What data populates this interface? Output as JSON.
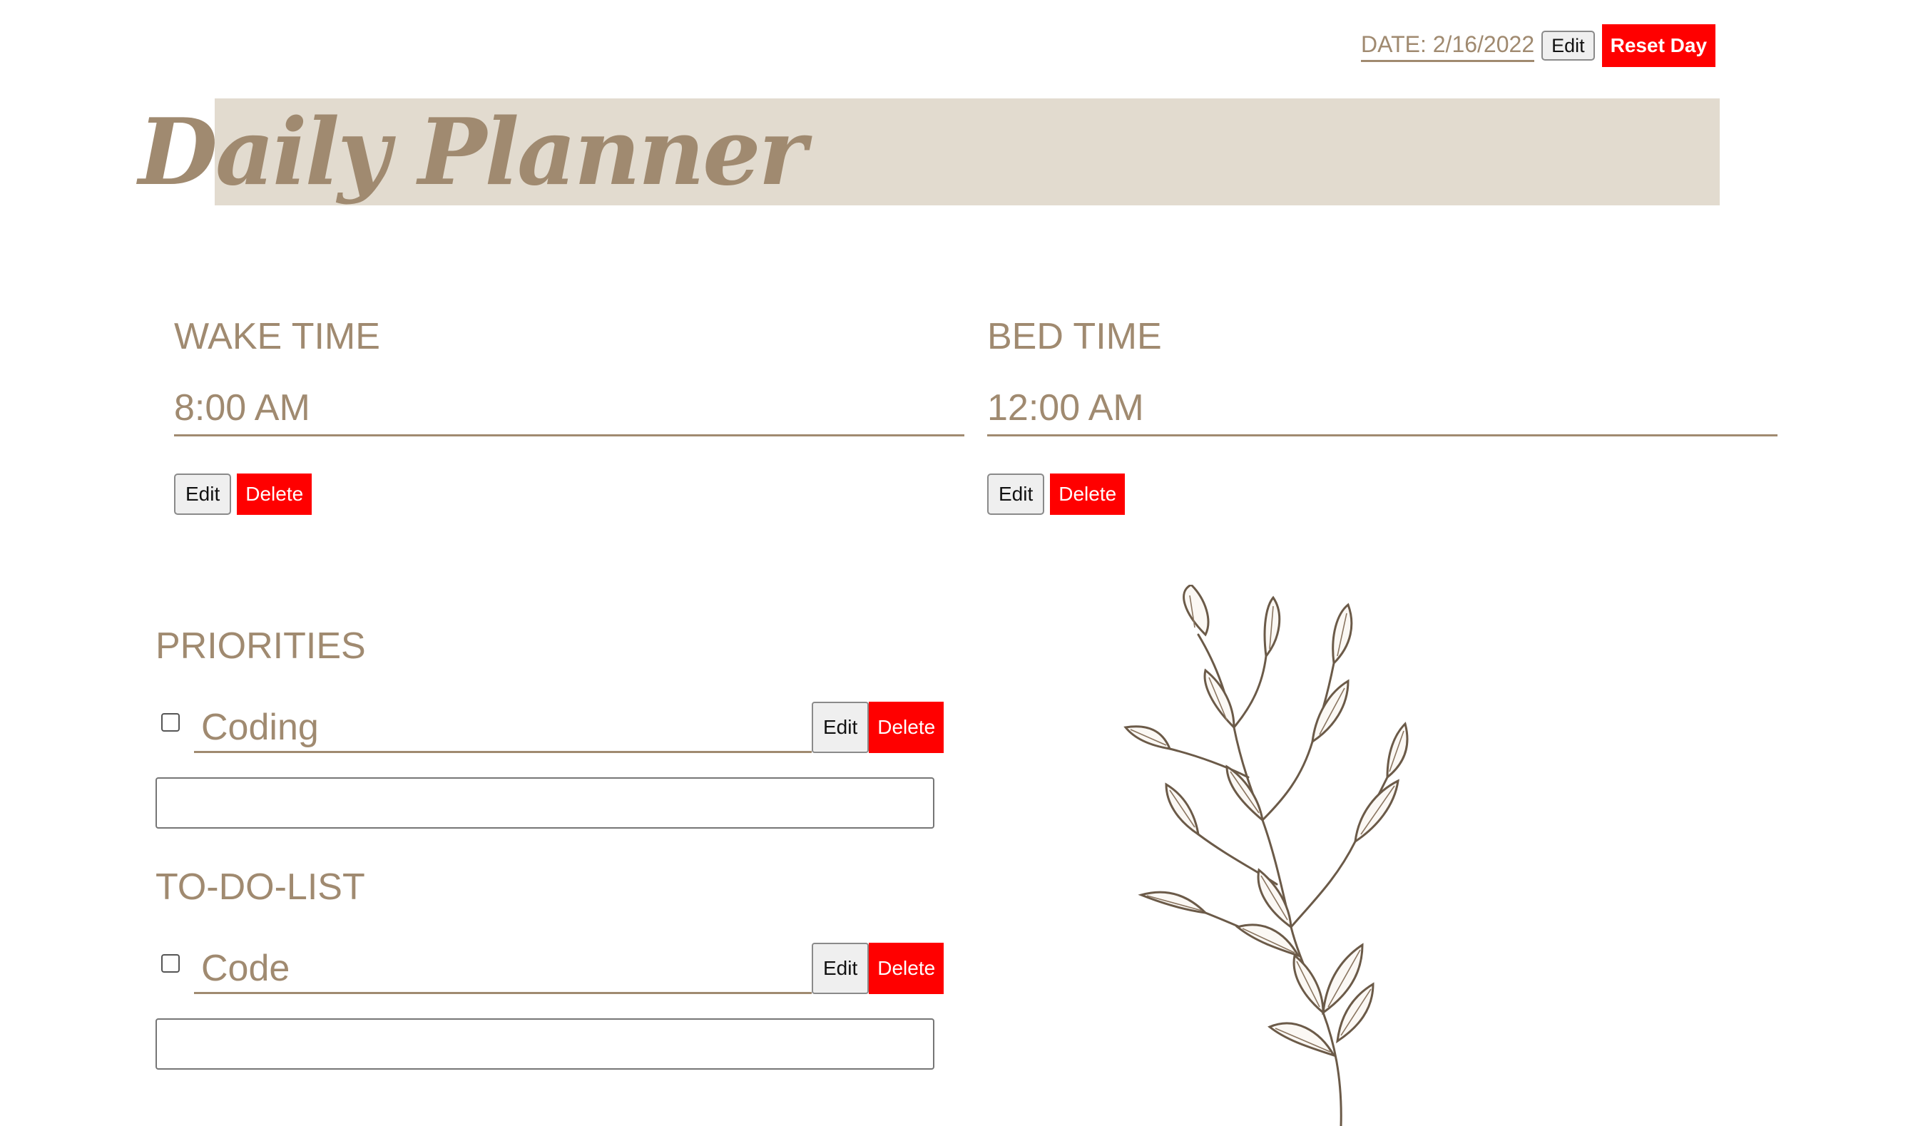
{
  "header": {
    "date_label": "DATE: 2/16/2022",
    "date_edit_label": "Edit",
    "reset_label": "Reset Day",
    "title": "Daily Planner"
  },
  "wake": {
    "heading": "WAKE TIME",
    "value": "8:00 AM",
    "edit_label": "Edit",
    "delete_label": "Delete"
  },
  "bed": {
    "heading": "BED TIME",
    "value": "12:00 AM",
    "edit_label": "Edit",
    "delete_label": "Delete"
  },
  "priorities": {
    "heading": "PRIORITIES",
    "items": [
      {
        "text": "Coding",
        "checked": false,
        "edit_label": "Edit",
        "delete_label": "Delete"
      }
    ],
    "new_item_value": ""
  },
  "todo": {
    "heading": "TO-DO-LIST",
    "items": [
      {
        "text": "Code",
        "checked": false,
        "edit_label": "Edit",
        "delete_label": "Delete"
      }
    ],
    "new_item_value": ""
  },
  "colors": {
    "accent": "#a08a70",
    "header_band": "#e2dbcf",
    "danger": "#ff0000",
    "button_gray": "#efefef"
  },
  "icons": {
    "illustration": "leaf-branch-illustration"
  }
}
